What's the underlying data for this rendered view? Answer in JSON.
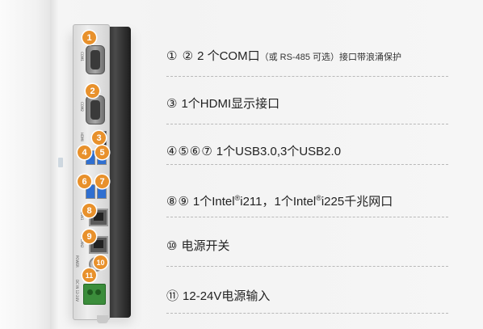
{
  "features": [
    {
      "nums": "① ②",
      "text": "2 个COM口",
      "note": "（或 RS-485 可选）",
      "tail": "接口带浪涌保护"
    },
    {
      "nums": "③",
      "text": "1个HDMI显示接口"
    },
    {
      "nums": "④⑤⑥⑦",
      "text": "1个USB3.0,3个USB2.0"
    },
    {
      "nums": "⑧⑨",
      "intel_a": "1个Intel",
      "reg": "®",
      "intel_b": "i211，1个Intel",
      "intel_c": "i225千兆网口"
    },
    {
      "nums": "⑩",
      "text": "电源开关"
    },
    {
      "nums": "⑪",
      "text": "12-24V电源输入"
    }
  ],
  "badges": [
    "1",
    "2",
    "3",
    "4",
    "5",
    "6",
    "7",
    "8",
    "9",
    "10",
    "11"
  ],
  "port_labels": {
    "com1": "COM1",
    "com2": "COM2",
    "hdmi": "HDMI",
    "lan1": "LAN1",
    "lan2": "LAN2",
    "power": "POWER",
    "dcin": "DC IN 12-24V"
  },
  "colors": {
    "badge": "#e8912c",
    "usb": "#2f6fd0",
    "terminal": "#3b8d3b"
  }
}
